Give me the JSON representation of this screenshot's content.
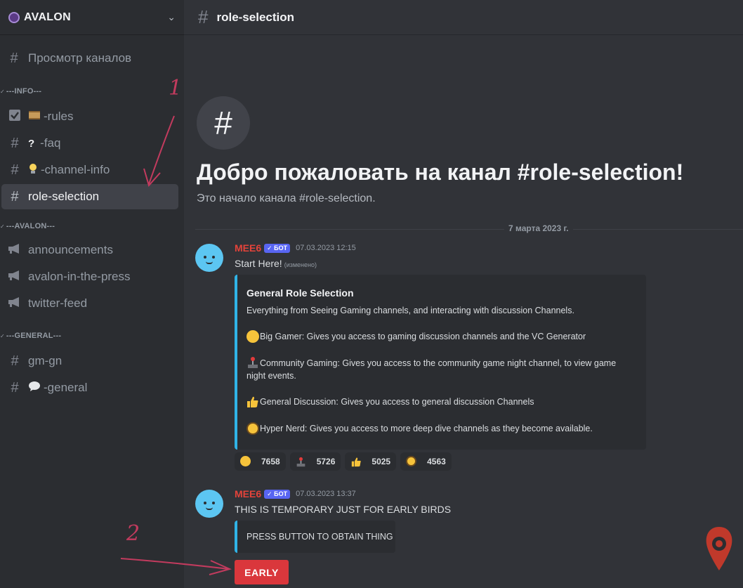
{
  "server": {
    "name": "AVALON"
  },
  "sidebar": {
    "browse_label": "Просмотр каналов",
    "categories": [
      {
        "label": "---INFO---",
        "channels": [
          "-rules",
          "-faq",
          "-channel-info",
          "role-selection"
        ]
      },
      {
        "label": "---AVALON---",
        "channels": [
          "announcements",
          "avalon-in-the-press",
          "twitter-feed"
        ]
      },
      {
        "label": "---GENERAL---",
        "channels": [
          "gm-gn",
          "-general"
        ]
      }
    ]
  },
  "channel": {
    "name": "role-selection"
  },
  "welcome": {
    "title": "Добро пожаловать на канал #role-selection!",
    "subtitle": "Это начало канала #role-selection."
  },
  "date_divider": "7 марта 2023 г.",
  "messages": [
    {
      "author": "MEE6",
      "badge": "✓ БОТ",
      "time": "07.03.2023 12:15",
      "text": "Start Here!",
      "edited": "(изменено)",
      "embed": {
        "title": "General Role Selection",
        "lines": [
          "Everything from Seeing Gaming channels, and interacting with discussion Channels.",
          "Big Gamer: Gives you access to gaming discussion channels and the VC Generator",
          "Community Gaming: Gives you access to the community game night channel, to view game",
          "night events.",
          "General Discussion: Gives you access to general discussion Channels",
          "Hyper Nerd: Gives you access to more deep dive channels as they become available."
        ]
      },
      "reactions": [
        {
          "icon": "grinning-face-icon",
          "count": "7658"
        },
        {
          "icon": "joystick-icon",
          "count": "5726"
        },
        {
          "icon": "thumbs-up-icon",
          "count": "5025"
        },
        {
          "icon": "nerd-face-icon",
          "count": "4563"
        }
      ]
    },
    {
      "author": "MEE6",
      "badge": "✓ БОТ",
      "time": "07.03.2023 13:37",
      "text": "THIS IS TEMPORARY JUST FOR EARLY BIRDS",
      "embed": {
        "text": "PRESS BUTTON TO OBTAIN THING"
      },
      "button": "EARLY"
    }
  ],
  "annotations": [
    "1",
    "2"
  ],
  "colors": {
    "accent": "#da373c",
    "embed_bar": "#30b3e6",
    "bot_badge": "#5865f2",
    "author": "#e4433a",
    "annotation": "#c23b5e"
  }
}
